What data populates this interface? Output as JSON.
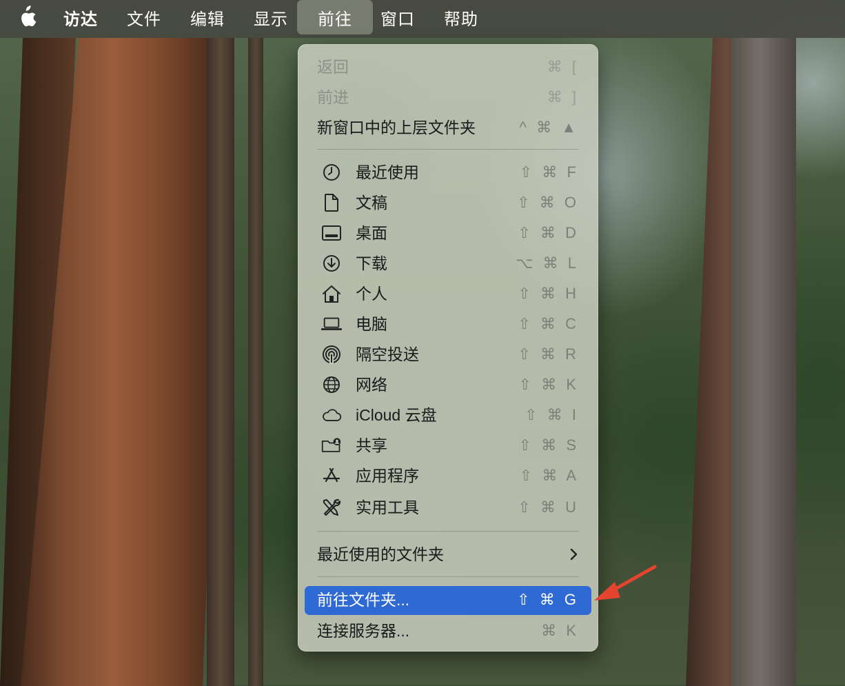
{
  "menubar": {
    "apple_icon": "apple-icon",
    "items": [
      {
        "label": "访达"
      },
      {
        "label": "文件"
      },
      {
        "label": "编辑"
      },
      {
        "label": "显示"
      },
      {
        "label": "前往"
      },
      {
        "label": "窗口"
      },
      {
        "label": "帮助"
      }
    ],
    "active_item": "前往"
  },
  "go_menu": {
    "top_items": [
      {
        "label": "返回",
        "shortcut": "⌘ [",
        "enabled": false
      },
      {
        "label": "前进",
        "shortcut": "⌘ ]",
        "enabled": false
      },
      {
        "label": "新窗口中的上层文件夹",
        "shortcut": "^ ⌘ ▲",
        "enabled": true
      }
    ],
    "locations": [
      {
        "label": "最近使用",
        "shortcut": "⇧ ⌘ F",
        "icon": "clock-icon"
      },
      {
        "label": "文稿",
        "shortcut": "⇧ ⌘ O",
        "icon": "document-icon"
      },
      {
        "label": "桌面",
        "shortcut": "⇧ ⌘ D",
        "icon": "desktop-icon"
      },
      {
        "label": "下载",
        "shortcut": "⌥ ⌘ L",
        "icon": "download-icon"
      },
      {
        "label": "个人",
        "shortcut": "⇧ ⌘ H",
        "icon": "home-icon"
      },
      {
        "label": "电脑",
        "shortcut": "⇧ ⌘ C",
        "icon": "laptop-icon"
      },
      {
        "label": "隔空投送",
        "shortcut": "⇧ ⌘ R",
        "icon": "airdrop-icon"
      },
      {
        "label": "网络",
        "shortcut": "⇧ ⌘ K",
        "icon": "globe-icon"
      },
      {
        "label": "iCloud 云盘",
        "shortcut": "⇧ ⌘ I",
        "icon": "cloud-icon"
      },
      {
        "label": "共享",
        "shortcut": "⇧ ⌘ S",
        "icon": "shared-folder-icon"
      },
      {
        "label": "应用程序",
        "shortcut": "⇧ ⌘ A",
        "icon": "applications-icon"
      },
      {
        "label": "实用工具",
        "shortcut": "⇧ ⌘ U",
        "icon": "utilities-icon"
      }
    ],
    "recent_folders": {
      "label": "最近使用的文件夹"
    },
    "go_to_folder": {
      "label": "前往文件夹...",
      "shortcut": "⇧ ⌘ G",
      "highlighted": true
    },
    "connect_server": {
      "label": "连接服务器...",
      "shortcut": "⌘ K"
    }
  },
  "colors": {
    "highlight": "#2f69d4",
    "annotation_arrow": "#e5442f"
  }
}
